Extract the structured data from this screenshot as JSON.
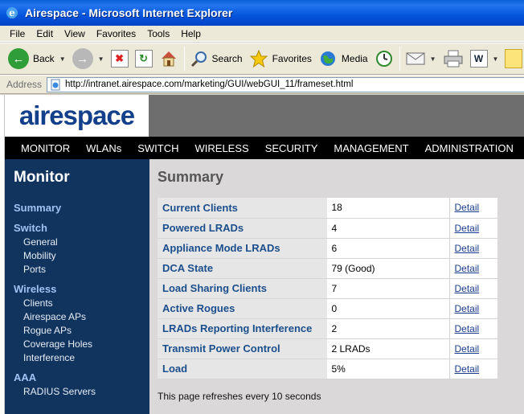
{
  "window": {
    "title": "Airespace - Microsoft Internet Explorer"
  },
  "menubar": {
    "items": [
      "File",
      "Edit",
      "View",
      "Favorites",
      "Tools",
      "Help"
    ]
  },
  "toolbar": {
    "back_label": "Back",
    "search_label": "Search",
    "favorites_label": "Favorites",
    "media_label": "Media"
  },
  "address": {
    "label": "Address",
    "url": "http://intranet.airespace.com/marketing/GUI/webGUI_11/frameset.html"
  },
  "brand": {
    "logo_text": "airespace"
  },
  "nav": {
    "items": [
      "MONITOR",
      "WLANs",
      "SWITCH",
      "WIRELESS",
      "SECURITY",
      "MANAGEMENT",
      "ADMINISTRATION"
    ]
  },
  "sidebar": {
    "heading": "Monitor",
    "summary": "Summary",
    "switch": {
      "label": "Switch",
      "items": [
        "General",
        "Mobility",
        "Ports"
      ]
    },
    "wireless": {
      "label": "Wireless",
      "items": [
        "Clients",
        "Airespace APs",
        "Rogue APs",
        "Coverage Holes",
        "Interference"
      ]
    },
    "aaa": {
      "label": "AAA",
      "items": [
        "RADIUS Servers"
      ]
    }
  },
  "content": {
    "heading": "Summary",
    "rows": [
      {
        "label": "Current Clients",
        "value": "18",
        "link": "Detail"
      },
      {
        "label": "Powered LRADs",
        "value": "4",
        "link": "Detail"
      },
      {
        "label": "Appliance Mode LRADs",
        "value": "6",
        "link": "Detail"
      },
      {
        "label": "DCA State",
        "value": "79 (Good)",
        "link": "Detail"
      },
      {
        "label": "Load Sharing Clients",
        "value": "7",
        "link": "Detail"
      },
      {
        "label": "Active Rogues",
        "value": "0",
        "link": "Detail"
      },
      {
        "label": "LRADs Reporting Interference",
        "value": "2",
        "link": "Detail"
      },
      {
        "label": "Transmit Power Control",
        "value": "2 LRADs",
        "link": "Detail"
      },
      {
        "label": "Load",
        "value": "5%",
        "link": "Detail"
      }
    ],
    "refresh_note": "This page refreshes every 10 seconds"
  }
}
